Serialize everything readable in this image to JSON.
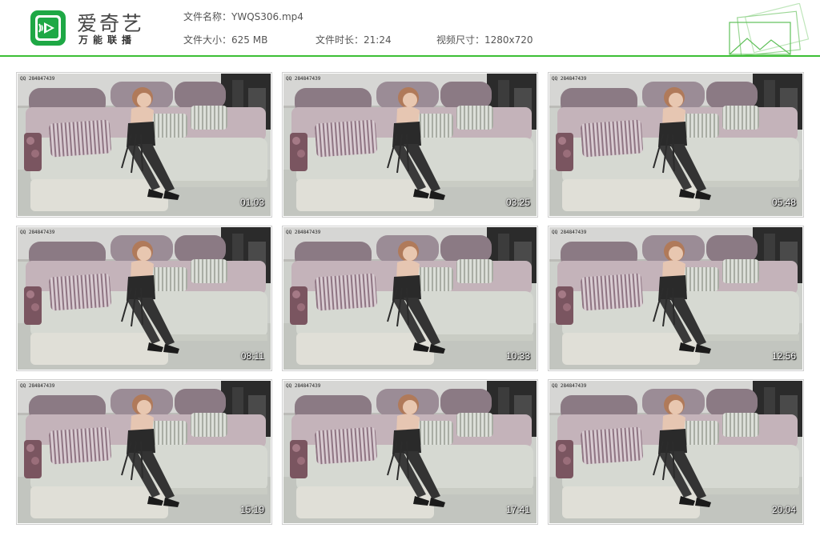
{
  "header": {
    "brand_title": "爱奇艺",
    "brand_subtitle": "万能联播",
    "file_name": "文件名称：YWQS306.mp4",
    "file_size": "文件大小：625 MB",
    "duration": "文件时长：21:24",
    "dimensions": "视频尺寸：1280x720"
  },
  "colors": {
    "accent": "#3cbf35",
    "brand_green": "#1ea845"
  },
  "thumbnails": [
    {
      "timestamp": "01:03",
      "watermark": "QQ 284847439"
    },
    {
      "timestamp": "03:25",
      "watermark": "QQ 284847439"
    },
    {
      "timestamp": "05:48",
      "watermark": "QQ 284847439"
    },
    {
      "timestamp": "08:11",
      "watermark": "QQ 284847439"
    },
    {
      "timestamp": "10:33",
      "watermark": "QQ 284847439"
    },
    {
      "timestamp": "12:56",
      "watermark": "QQ 284847439"
    },
    {
      "timestamp": "15:19",
      "watermark": "QQ 284847439"
    },
    {
      "timestamp": "17:41",
      "watermark": "QQ 284847439"
    },
    {
      "timestamp": "20:04",
      "watermark": "QQ 284847439"
    }
  ]
}
